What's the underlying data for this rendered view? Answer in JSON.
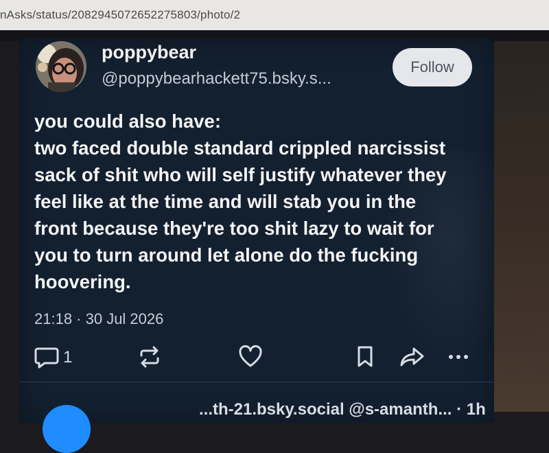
{
  "browser": {
    "url_text": "nAsks/status/2082945072652275803/photo/2"
  },
  "post": {
    "author": {
      "display_name": "poppybear",
      "handle": "@poppybearhackett75.bsky.s..."
    },
    "follow_label": "Follow",
    "text_lines": [
      "you could also have:",
      "two faced double standard crippled narcissist",
      "sack of shit who will self justify whatever they",
      "feel like at the time and will stab you in the",
      "front because they're too shit lazy to wait for",
      "you to turn around let alone do the fucking",
      "hoovering."
    ],
    "timestamp": "21:18 · 30 Jul 2026",
    "reply_count": "1",
    "icons": {
      "reply": "reply-icon",
      "repost": "repost-icon",
      "like": "heart-icon",
      "bookmark": "bookmark-icon",
      "share": "share-icon",
      "more": "more-icon"
    }
  },
  "next_post": {
    "header_text": "...th-21.bsky.social @s-amanth... · 1h"
  },
  "colors": {
    "card_bg": "#132030",
    "text": "#f4f4f4",
    "follow_bg": "#e6e7ea"
  }
}
